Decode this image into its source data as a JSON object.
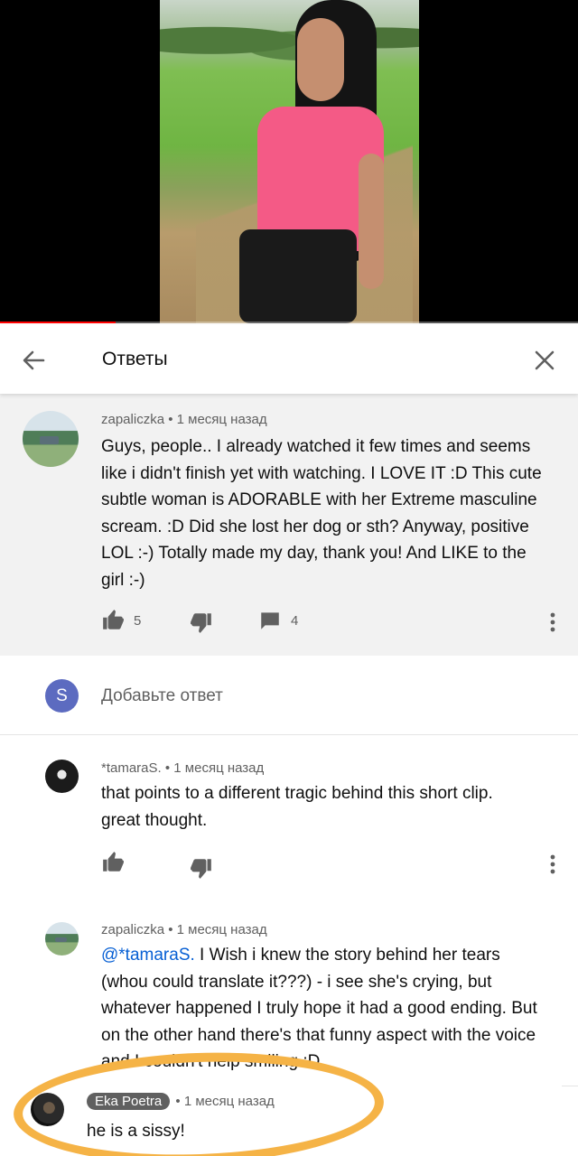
{
  "video": {
    "progress": 0.2
  },
  "header": {
    "title": "Ответы"
  },
  "parent_comment": {
    "author": "zapaliczka",
    "time": "1 месяц назад",
    "text_lines": [
      "Guys, people.. I already watched it few times and seems",
      "like i didn't finish yet with watching. I LOVE IT :D This cute",
      "subtle woman is ADORABLE with her Extreme masculine",
      "scream. :D Did she lost her dog or sth? Anyway, positive",
      "LOL :-) Totally made my day, thank you! And LIKE to the",
      "girl :-)"
    ],
    "likes": "5",
    "replies": "4"
  },
  "add_reply": {
    "avatar_letter": "S",
    "placeholder": "Добавьте ответ"
  },
  "replies": [
    {
      "author": "*tamaraS.",
      "time": "1 месяц назад",
      "text_lines": [
        "that points to a different tragic behind this short clip.",
        "great thought."
      ]
    },
    {
      "author": "zapaliczka",
      "time": "1 месяц назад",
      "mention": "@*tamaraS.",
      "first_line_rest": " I Wish i knew the story behind her tears",
      "text_lines": [
        "(whou could translate it???) - i see she's crying, but",
        "whatever happened I truly hope it had a good ending. But",
        "on the other hand there's that funny aspect with the voice",
        "and I couldn't help smiling :D"
      ]
    },
    {
      "author": "Eka Poetra",
      "time": "1 месяц назад",
      "text": "he is a sissy!"
    }
  ],
  "colors": {
    "accent": "#065fd4",
    "highlight": "#f5b346",
    "progress": "#ff0000"
  }
}
